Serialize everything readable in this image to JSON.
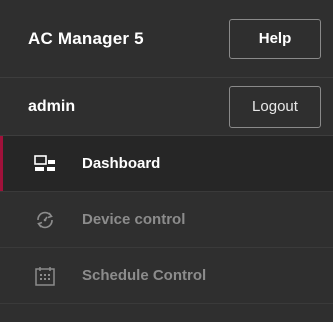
{
  "header": {
    "app_title": "AC Manager 5",
    "help_label": "Help"
  },
  "user": {
    "name": "admin",
    "logout_label": "Logout"
  },
  "nav": {
    "items": [
      {
        "label": "Dashboard",
        "icon": "dashboard-icon",
        "active": true
      },
      {
        "label": "Device control",
        "icon": "device-control-icon",
        "active": false
      },
      {
        "label": "Schedule Control",
        "icon": "calendar-icon",
        "active": false
      }
    ]
  },
  "colors": {
    "background": "#2f2f2f",
    "active_background": "#262626",
    "active_accent": "#a0113a",
    "inactive_text": "#8c8c8c"
  }
}
